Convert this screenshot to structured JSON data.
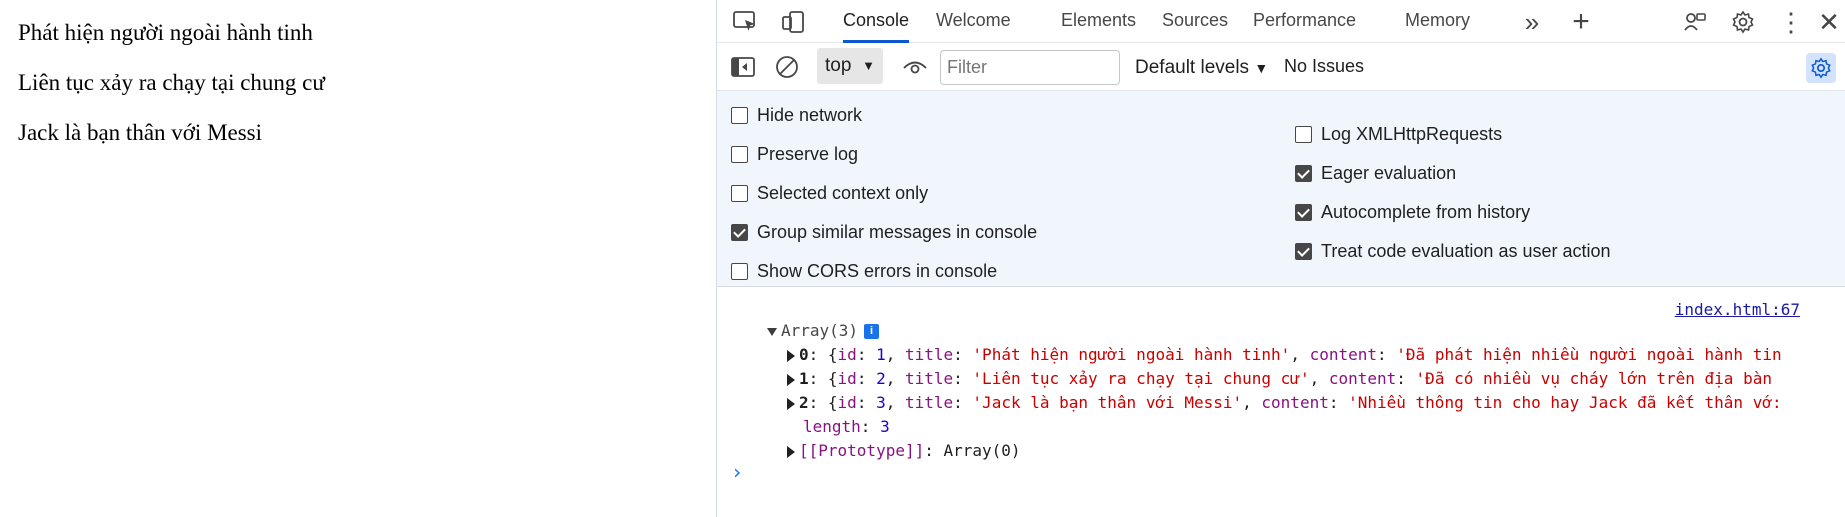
{
  "page": {
    "headlines": [
      "Phát hiện người ngoài hành tinh",
      "Liên tục xảy ra chạy tại chung cư",
      "Jack là bạn thân với Messi"
    ]
  },
  "devtools": {
    "tabs": [
      {
        "label": "Console",
        "active": true
      },
      {
        "label": "Welcome"
      },
      {
        "label": "Elements"
      },
      {
        "label": "Sources"
      },
      {
        "label": "Performance"
      },
      {
        "label": "Memory"
      }
    ],
    "toolbar": {
      "context": "top",
      "filter_placeholder": "Filter",
      "levels": "Default levels",
      "issues": "No Issues"
    },
    "settings": {
      "left": [
        {
          "label": "Hide network",
          "checked": false
        },
        {
          "label": "Preserve log",
          "checked": false
        },
        {
          "label": "Selected context only",
          "checked": false
        },
        {
          "label": "Group similar messages in console",
          "checked": true
        },
        {
          "label": "Show CORS errors in console",
          "checked": false
        }
      ],
      "right": [
        {
          "label": "Log XMLHttpRequests",
          "checked": false
        },
        {
          "label": "Eager evaluation",
          "checked": true
        },
        {
          "label": "Autocomplete from history",
          "checked": true
        },
        {
          "label": "Treat code evaluation as user action",
          "checked": true
        }
      ]
    },
    "console": {
      "source": "index.html:67",
      "array_label": "Array(3)",
      "items": [
        {
          "index": "0",
          "id": "1",
          "title": "'Phát hiện người ngoài hành tinh'",
          "content": "'Đã phát hiện nhiều người ngoài hành tin"
        },
        {
          "index": "1",
          "id": "2",
          "title": "'Liên tục xảy ra chạy tại chung cư'",
          "content": "'Đã có nhiều vụ cháy lớn trên địa bàn"
        },
        {
          "index": "2",
          "id": "3",
          "title": "'Jack là bạn thân với Messi'",
          "content": "'Nhiều thông tin cho hay Jack đã kết thân vớ:"
        }
      ],
      "length_key": "length",
      "length_value": "3",
      "prototype_key": "[[Prototype]]",
      "prototype_value": "Array(0)"
    }
  }
}
